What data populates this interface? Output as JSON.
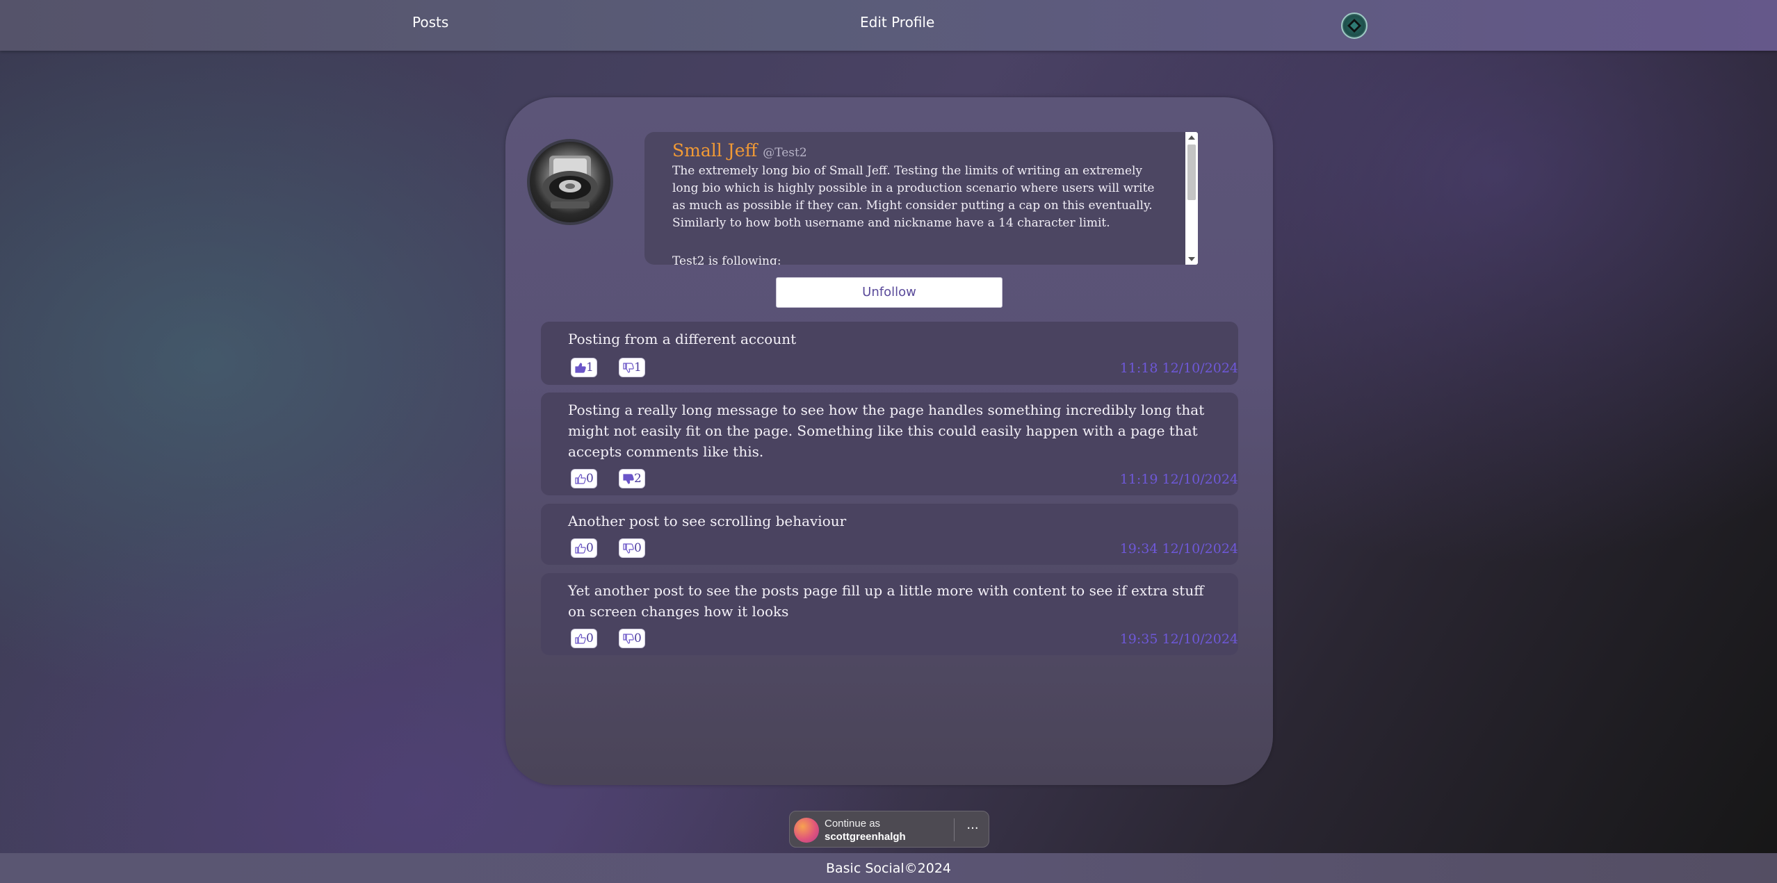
{
  "nav": {
    "posts_label": "Posts",
    "edit_profile_label": "Edit Profile"
  },
  "profile": {
    "nickname": "Small Jeff",
    "handle": "@Test2",
    "bio": "The extremely long bio of Small Jeff. Testing the limits of writing an extremely long bio which is highly possible in a production scenario where users will write as much as possible if they can. Might consider putting a cap on this eventually. Similarly to how both username and nickname have a 14 character limit.",
    "following_label": "Test2 is following:",
    "unfollow_label": "Unfollow"
  },
  "posts": [
    {
      "text": "Posting from a different account",
      "likes": "1",
      "dislikes": "1",
      "liked": true,
      "disliked": false,
      "time": "11:18 12/10/2024"
    },
    {
      "text": "Posting a really long message to see how the page handles something incredibly long that might not easily fit on the page. Something like this could easily happen with a page that accepts comments like this.",
      "likes": "0",
      "dislikes": "2",
      "liked": false,
      "disliked": true,
      "time": "11:19 12/10/2024"
    },
    {
      "text": "Another post to see scrolling behaviour",
      "likes": "0",
      "dislikes": "0",
      "liked": false,
      "disliked": false,
      "time": "19:34 12/10/2024"
    },
    {
      "text": "Yet another post to see the posts page fill up a little more with content to see if extra stuff on screen changes how it looks",
      "likes": "0",
      "dislikes": "0",
      "liked": false,
      "disliked": false,
      "time": "19:35 12/10/2024"
    }
  ],
  "google_prompt": {
    "line1": "Continue as",
    "line2": "scottgreenhalgh",
    "more": "···"
  },
  "footer": {
    "text": "Basic Social©2024"
  },
  "colors": {
    "accent": "#6e58d8",
    "nickname": "#f29a35"
  },
  "icons": {
    "like": "thumbs-up-icon",
    "dislike": "thumbs-down-icon",
    "avatar": "user-avatar-icon"
  }
}
